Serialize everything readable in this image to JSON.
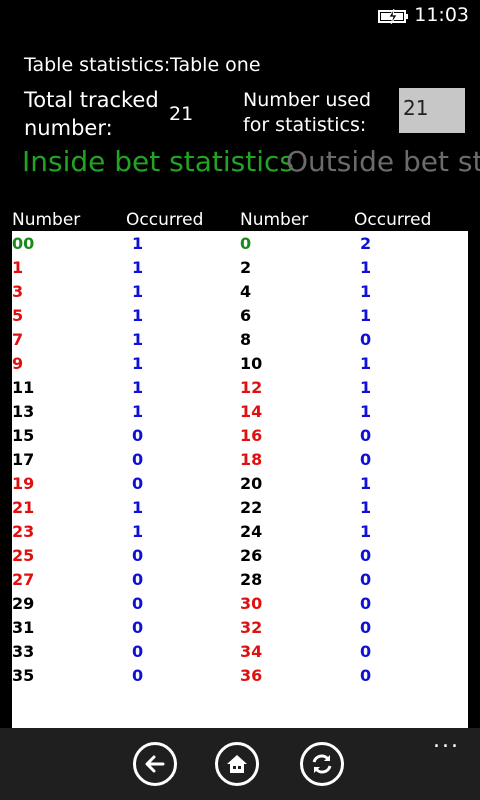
{
  "status": {
    "time": "11:03"
  },
  "header": {
    "table_statistics_label": "Table statistics:",
    "table_name": "Table one",
    "total_tracked_label": "Total tracked number:",
    "total_tracked_value": "21",
    "number_used_label": "Number used for statistics:",
    "number_used_value": "21"
  },
  "pivot": {
    "tab_inside": "Inside bet statistics",
    "tab_outside": "Outside bet statistics"
  },
  "columns": {
    "number1": "Number",
    "occurred1": "Occurred",
    "number2": "Number",
    "occurred2": "Occurred"
  },
  "rows": [
    {
      "n1": "00",
      "c1": "green",
      "o1": "1",
      "n2": "0",
      "c2": "green",
      "o2": "2"
    },
    {
      "n1": "1",
      "c1": "red",
      "o1": "1",
      "n2": "2",
      "c2": "black",
      "o2": "1"
    },
    {
      "n1": "3",
      "c1": "red",
      "o1": "1",
      "n2": "4",
      "c2": "black",
      "o2": "1"
    },
    {
      "n1": "5",
      "c1": "red",
      "o1": "1",
      "n2": "6",
      "c2": "black",
      "o2": "1"
    },
    {
      "n1": "7",
      "c1": "red",
      "o1": "1",
      "n2": "8",
      "c2": "black",
      "o2": "0"
    },
    {
      "n1": "9",
      "c1": "red",
      "o1": "1",
      "n2": "10",
      "c2": "black",
      "o2": "1"
    },
    {
      "n1": "11",
      "c1": "black",
      "o1": "1",
      "n2": "12",
      "c2": "red",
      "o2": "1"
    },
    {
      "n1": "13",
      "c1": "black",
      "o1": "1",
      "n2": "14",
      "c2": "red",
      "o2": "1"
    },
    {
      "n1": "15",
      "c1": "black",
      "o1": "0",
      "n2": "16",
      "c2": "red",
      "o2": "0"
    },
    {
      "n1": "17",
      "c1": "black",
      "o1": "0",
      "n2": "18",
      "c2": "red",
      "o2": "0"
    },
    {
      "n1": "19",
      "c1": "red",
      "o1": "0",
      "n2": "20",
      "c2": "black",
      "o2": "1"
    },
    {
      "n1": "21",
      "c1": "red",
      "o1": "1",
      "n2": "22",
      "c2": "black",
      "o2": "1"
    },
    {
      "n1": "23",
      "c1": "red",
      "o1": "1",
      "n2": "24",
      "c2": "black",
      "o2": "1"
    },
    {
      "n1": "25",
      "c1": "red",
      "o1": "0",
      "n2": "26",
      "c2": "black",
      "o2": "0"
    },
    {
      "n1": "27",
      "c1": "red",
      "o1": "0",
      "n2": "28",
      "c2": "black",
      "o2": "0"
    },
    {
      "n1": "29",
      "c1": "black",
      "o1": "0",
      "n2": "30",
      "c2": "red",
      "o2": "0"
    },
    {
      "n1": "31",
      "c1": "black",
      "o1": "0",
      "n2": "32",
      "c2": "red",
      "o2": "0"
    },
    {
      "n1": "33",
      "c1": "black",
      "o1": "0",
      "n2": "34",
      "c2": "red",
      "o2": "0"
    },
    {
      "n1": "35",
      "c1": "black",
      "o1": "0",
      "n2": "36",
      "c2": "red",
      "o2": "0"
    }
  ],
  "app_bar": {
    "buttons": [
      "back-arrow-icon",
      "home-icon",
      "refresh-icon"
    ],
    "more": "..."
  },
  "colors": {
    "green": "#1a8a1a",
    "red": "#e01010",
    "blue": "#1010d8",
    "inside_tab": "#22a322",
    "outside_tab": "#6b6b6b"
  }
}
